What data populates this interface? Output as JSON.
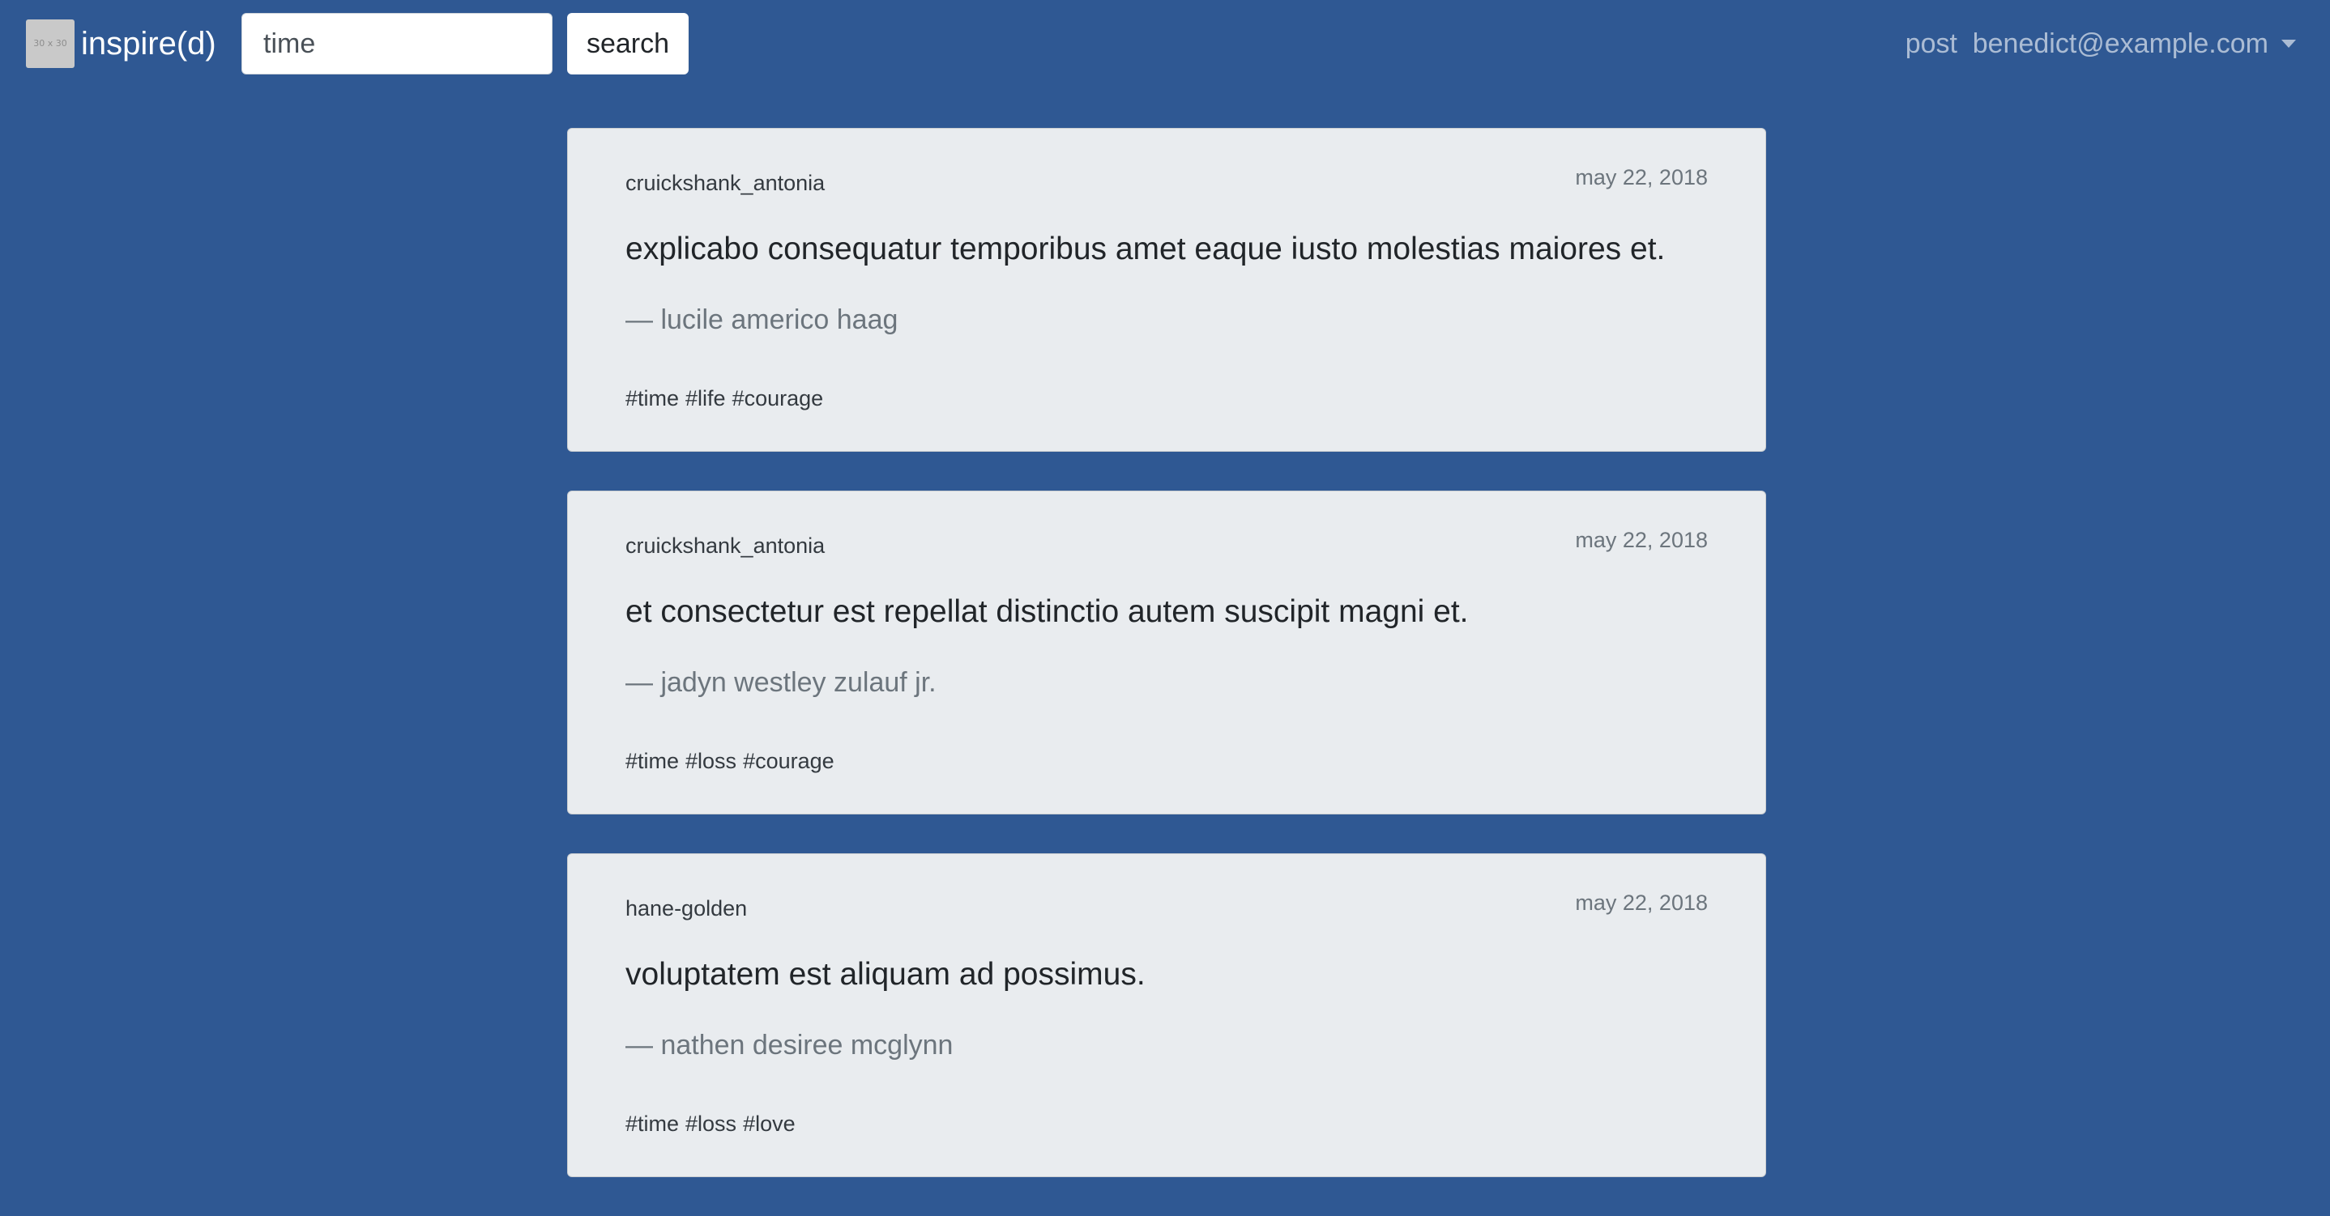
{
  "navbar": {
    "logo_text": "30 x 30",
    "brand": "inspire(d)",
    "search_value": "time",
    "search_button": "search",
    "post_link": "post",
    "user_email": "benedict@example.com"
  },
  "posts": [
    {
      "user": "cruickshank_antonia",
      "date": "may 22, 2018",
      "quote": "explicabo consequatur temporibus amet eaque iusto molestias maiores et.",
      "author": "— lucile americo haag",
      "tags": [
        "#time",
        "#life",
        "#courage"
      ]
    },
    {
      "user": "cruickshank_antonia",
      "date": "may 22, 2018",
      "quote": "et consectetur est repellat distinctio autem suscipit magni et.",
      "author": "— jadyn westley zulauf jr.",
      "tags": [
        "#time",
        "#loss",
        "#courage"
      ]
    },
    {
      "user": "hane-golden",
      "date": "may 22, 2018",
      "quote": "voluptatem est aliquam ad possimus.",
      "author": "— nathen desiree mcglynn",
      "tags": [
        "#time",
        "#loss",
        "#love"
      ]
    }
  ]
}
